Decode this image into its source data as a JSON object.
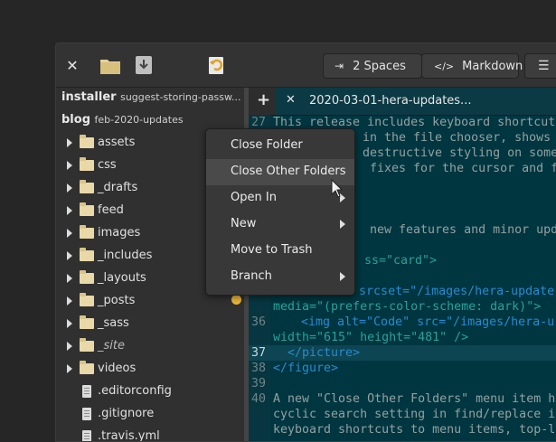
{
  "headerbar": {
    "indent_label": "2 Spaces",
    "language_label": "Markdown",
    "language_icon_text": "</>"
  },
  "sidebar": {
    "projects": [
      {
        "name": "installer",
        "branch": "suggest-storing-passw..."
      },
      {
        "name": "blog",
        "branch": "feb-2020-updates"
      }
    ],
    "items": [
      {
        "label": "assets",
        "type": "folder"
      },
      {
        "label": "css",
        "type": "folder"
      },
      {
        "label": "_drafts",
        "type": "folder"
      },
      {
        "label": "feed",
        "type": "folder"
      },
      {
        "label": "images",
        "type": "folder"
      },
      {
        "label": "_includes",
        "type": "folder"
      },
      {
        "label": "_layouts",
        "type": "folder"
      },
      {
        "label": "_posts",
        "type": "folder"
      },
      {
        "label": "_sass",
        "type": "folder"
      },
      {
        "label": "_site",
        "type": "folder",
        "italic": true
      },
      {
        "label": "videos",
        "type": "folder"
      },
      {
        "label": ".editorconfig",
        "type": "file"
      },
      {
        "label": ".gitignore",
        "type": "file"
      },
      {
        "label": ".travis.yml",
        "type": "file"
      }
    ]
  },
  "editor": {
    "new_tab_symbol": "+",
    "tab_title": "2020-03-01-hera-updates...",
    "lines": [
      {
        "n": "27",
        "t": "This release includes keyboard shortcut"
      },
      {
        "n": "",
        "t": "in the file chooser, shows "
      },
      {
        "n": "",
        "t": "destructive styling on some"
      },
      {
        "n": "",
        "t": "fixes for the cursor and fol"
      },
      {
        "n": "",
        "t": "new features and minor update"
      },
      {
        "n": "",
        "t": "ss=\"card\">"
      },
      {
        "n": "35",
        "t": "<source srcset=\"/images/hera-update"
      },
      {
        "n": "",
        "t": "media=\"(prefers-color-scheme: dark)\">"
      },
      {
        "n": "36",
        "t": "<img alt=\"Code\" src=\"/images/hera-u"
      },
      {
        "n": "",
        "t": "width=\"615\" height=\"481\" />"
      },
      {
        "n": "37",
        "t": "</picture>"
      },
      {
        "n": "38",
        "t": "</figure>"
      },
      {
        "n": "39",
        "t": ""
      },
      {
        "n": "40",
        "t": "A new \"Close Other Folders\" menu item h"
      },
      {
        "n": "",
        "t": "cyclic search setting in find/replace i"
      },
      {
        "n": "",
        "t": "keyboard shortcuts to menu items, top-l"
      }
    ]
  },
  "context_menu": {
    "items": [
      {
        "label": "Close Folder",
        "submenu": false
      },
      {
        "label": "Close Other Folders",
        "submenu": false,
        "highlighted": true
      },
      {
        "label": "Open In",
        "submenu": true
      },
      {
        "label": "New",
        "submenu": true
      },
      {
        "label": "Move to Trash",
        "submenu": false
      },
      {
        "label": "Branch",
        "submenu": true
      }
    ]
  },
  "colors": {
    "editor_bg": "#003640",
    "folder": "#e9d9a8",
    "modified_dot": "#e8b73a"
  }
}
